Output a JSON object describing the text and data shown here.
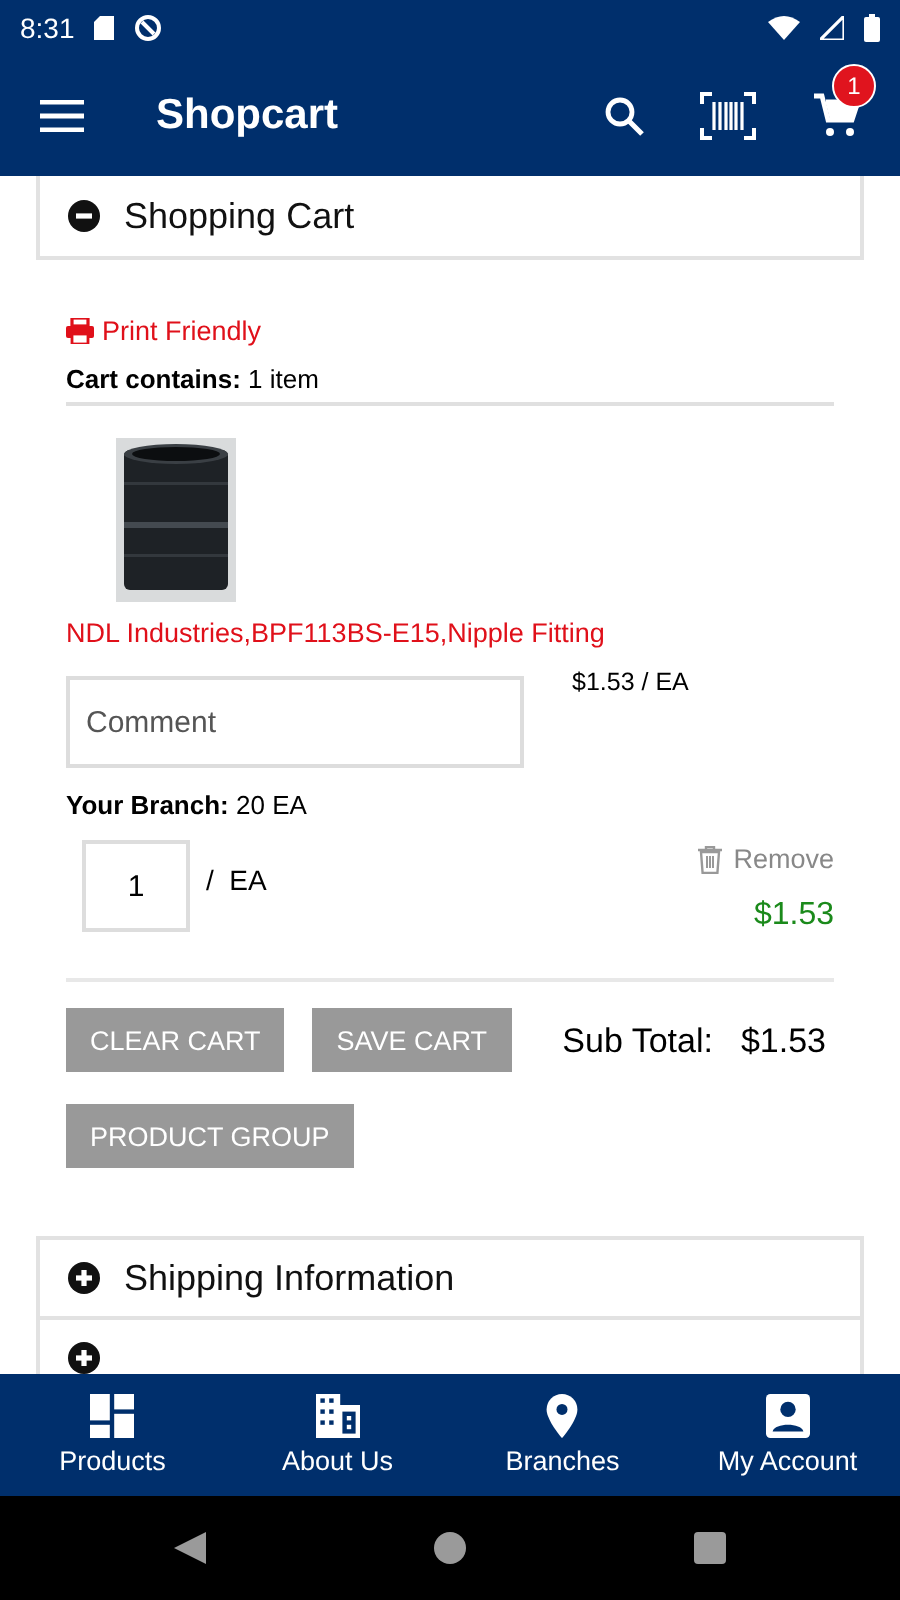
{
  "status_bar": {
    "time": "8:31"
  },
  "app_bar": {
    "title": "Shopcart",
    "cart_badge": "1"
  },
  "sections": [
    {
      "title": "Shopping Cart",
      "expanded": true
    },
    {
      "title": "Shipping Information",
      "expanded": false
    },
    {
      "expanded": false
    }
  ],
  "cart": {
    "print_link": "Print Friendly",
    "contains_label": "Cart contains:",
    "contains_value": "1 item",
    "items": [
      {
        "name": "NDL Industries,BPF113BS-E15,Nipple Fitting",
        "unit_price": "$1.53 / EA",
        "comment_placeholder": "Comment",
        "branch_label": "Your Branch:",
        "branch_value": "20 EA",
        "quantity": "1",
        "unit": "/  EA",
        "remove": "Remove",
        "total": "$1.53"
      }
    ],
    "buttons": [
      "CLEAR CART",
      "SAVE CART",
      "PRODUCT GROUP"
    ],
    "subtotal_label": "Sub Total:",
    "subtotal_value": "$1.53"
  },
  "bottom_nav": [
    {
      "label": "Products",
      "kind": "grid"
    },
    {
      "label": "About Us",
      "kind": "building"
    },
    {
      "label": "Branches",
      "kind": "pin"
    },
    {
      "label": "My Account",
      "kind": "account"
    }
  ]
}
